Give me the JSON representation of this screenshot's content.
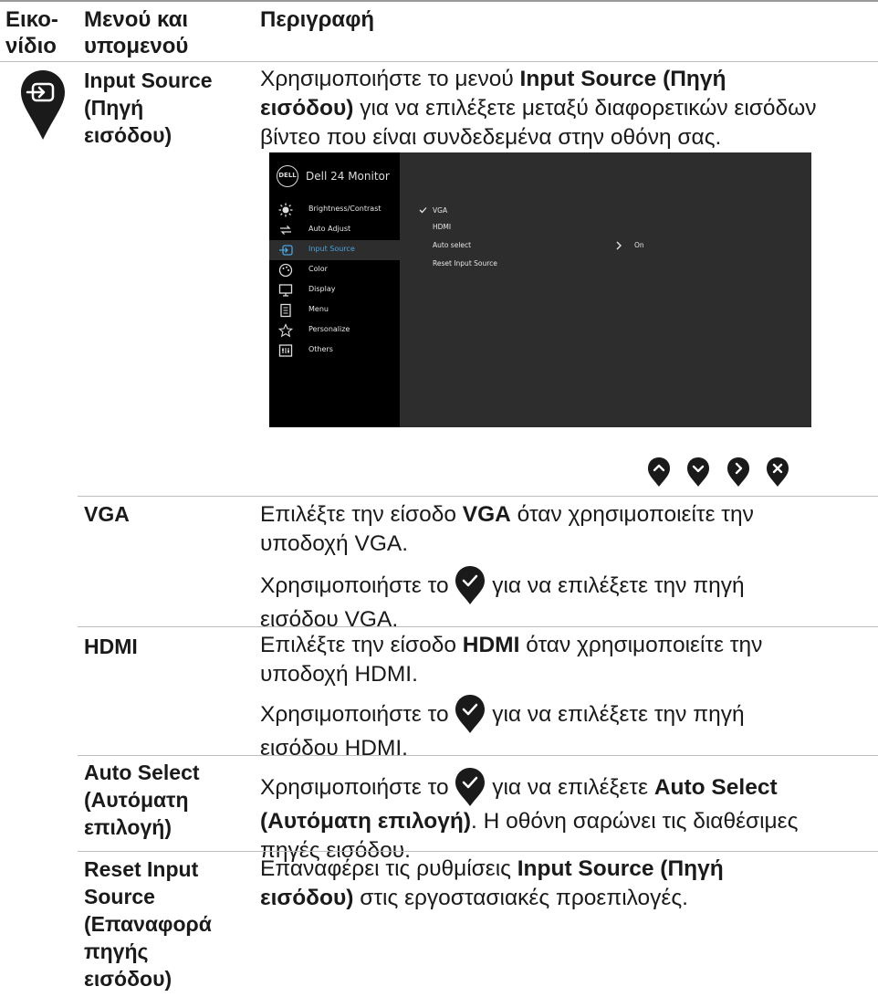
{
  "header": {
    "col1_line1": "Εικο-",
    "col1_line2": "νίδιο",
    "col2_line1": "Μενού και",
    "col2_line2": "υπομενού",
    "col3": "Περιγραφή"
  },
  "input_source": {
    "label_line1": "Input Source",
    "label_line2": "(Πηγή",
    "label_line3": "εισόδου)",
    "desc_a": "Χρησιμοποιήστε το μενού ",
    "desc_b": "Input Source (Πηγή",
    "desc_c": "εισόδου)",
    "desc_d": " για να επιλέξετε μεταξύ διαφορετικών εισόδων",
    "desc_e": "βίντεο που είναι συνδεδεμένα στην οθόνη σας."
  },
  "osd": {
    "logo": "DELL",
    "title": "Dell 24 Monitor",
    "menu": [
      {
        "label": "Brightness/Contrast",
        "icon": "brightness-icon"
      },
      {
        "label": "Auto Adjust",
        "icon": "auto-adjust-icon"
      },
      {
        "label": "Input Source",
        "icon": "input-source-icon",
        "active": true
      },
      {
        "label": "Color",
        "icon": "color-palette-icon"
      },
      {
        "label": "Display",
        "icon": "display-icon"
      },
      {
        "label": "Menu",
        "icon": "menu-icon"
      },
      {
        "label": "Personalize",
        "icon": "star-icon"
      },
      {
        "label": "Others",
        "icon": "others-icon"
      }
    ],
    "options": [
      "VGA",
      "HDMI",
      "Auto select",
      "Reset Input Source"
    ],
    "selected_option": "VGA",
    "auto_select_value": "On",
    "accent_color": "#4aa3df"
  },
  "nav_buttons": [
    "up-button-icon",
    "down-button-icon",
    "right-button-icon",
    "close-button-icon"
  ],
  "vga": {
    "label": "VGA",
    "desc1_a": "Επιλέξτε την είσοδο ",
    "desc1_b": "VGA",
    "desc1_c": " όταν χρησιμοποιείτε την",
    "desc1_d": "υποδοχή VGA.",
    "desc2_a": "Χρησιμοποιήστε το ",
    "desc2_b": " για να επιλέξετε την πηγή",
    "desc2_c": "εισόδου VGA."
  },
  "hdmi": {
    "label": "HDMI",
    "desc1_a": "Επιλέξτε την είσοδο ",
    "desc1_b": "HDMI",
    "desc1_c": " όταν χρησιμοποιείτε την",
    "desc1_d": "υποδοχή HDMI.",
    "desc2_a": "Χρησιμοποιήστε το ",
    "desc2_b": " για να επιλέξετε την πηγή",
    "desc2_c": "εισόδου HDMI."
  },
  "auto_select": {
    "label_line1": "Auto Select",
    "label_line2": "(Αυτόματη",
    "label_line3": "επιλογή)",
    "desc_a": "Χρησιμοποιήστε το ",
    "desc_b": " για να επιλέξετε ",
    "desc_c": "Auto Select",
    "desc_d": "(Αυτόματη επιλογή)",
    "desc_e": ". Η οθόνη σαρώνει τις διαθέσιμες",
    "desc_f": "πηγές εισόδου."
  },
  "reset": {
    "label_line1": "Reset Input",
    "label_line2": "Source",
    "label_line3": "(Επαναφορά",
    "label_line4": "πηγής",
    "label_line5": "εισόδου)",
    "desc_a": "Επαναφέρει τις ρυθμίσεις ",
    "desc_b": "Input Source (Πηγή",
    "desc_c": "εισόδου)",
    "desc_d": " στις εργοστασιακές προεπιλογές."
  }
}
